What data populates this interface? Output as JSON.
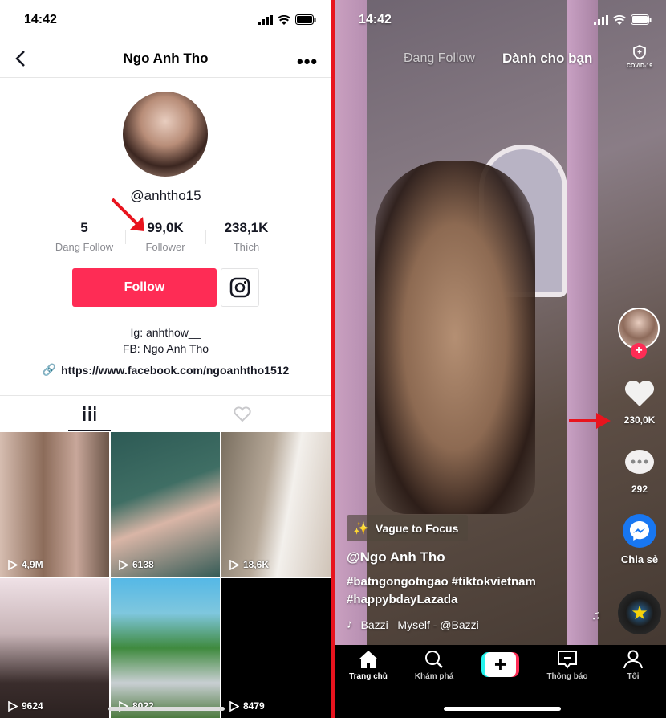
{
  "profile_screen": {
    "status_time": "14:42",
    "header_title": "Ngo Anh Tho",
    "username": "@anhtho15",
    "stats": [
      {
        "value": "5",
        "label": "Đang Follow"
      },
      {
        "value": "99,0K",
        "label": "Follower"
      },
      {
        "value": "238,1K",
        "label": "Thích"
      }
    ],
    "follow_label": "Follow",
    "bio": [
      "Ig: anhthow__",
      "FB: Ngo Anh Tho"
    ],
    "link": "https://www.facebook.com/ngoanhtho1512",
    "videos": [
      {
        "views": "4,9M"
      },
      {
        "views": "6138"
      },
      {
        "views": "18,6K"
      },
      {
        "views": "9624"
      },
      {
        "views": "8022"
      },
      {
        "views": "8479"
      }
    ],
    "annotation_color": "#e8141e",
    "accent": "#fe2c55"
  },
  "feed_screen": {
    "status_time": "14:42",
    "tabs": [
      "Đang Follow",
      "Dành cho bạn"
    ],
    "covid_label": "COVID-19",
    "likes": "230,0K",
    "comments": "292",
    "share_label": "Chia sẻ",
    "effect": "Vague to Focus",
    "author": "@Ngo Anh Tho",
    "hashtags": [
      "#batngongotngao #tiktokvietnam",
      "#happybdayLazada"
    ],
    "music": "Bazzi   Myself - @Bazzi",
    "nav": [
      "Trang chủ",
      "Khám phá",
      "",
      "Thông báo",
      "Tôi"
    ]
  }
}
